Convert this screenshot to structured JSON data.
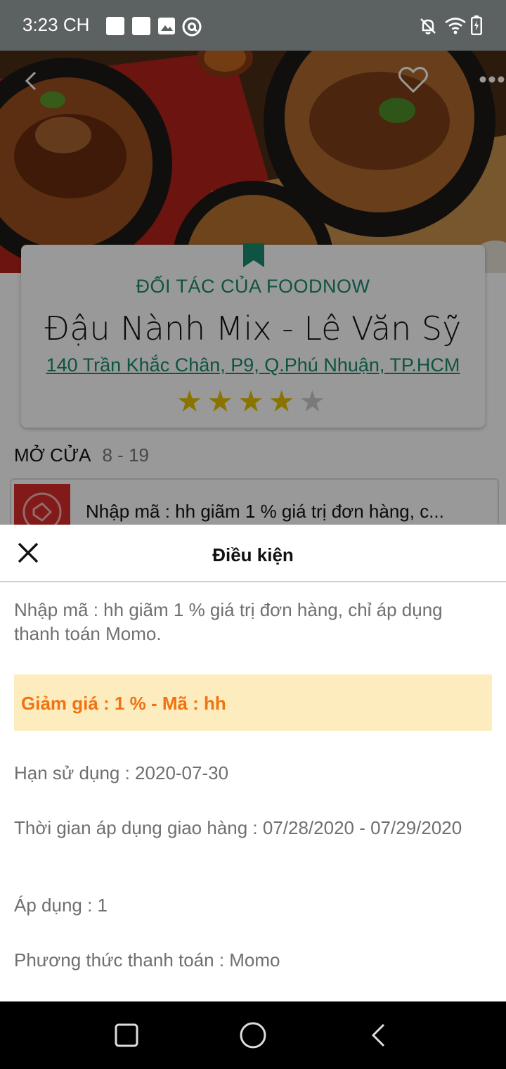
{
  "status_bar": {
    "time": "3:23 CH"
  },
  "restaurant": {
    "partner_label": "ĐỐI TÁC CỦA FOODNOW",
    "name": "Đậu Nành Mix - Lê Văn Sỹ",
    "address": "140 Trần Khắc Chân, P9, Q.Phú Nhuận, TP.HCM",
    "rating": 4,
    "rating_max": 5,
    "hours_label": "MỞ CỬA",
    "hours_value": "8 - 19",
    "coupon_text": "Nhập mã : hh giãm 1 % giá trị đơn hàng, c..."
  },
  "sheet": {
    "title": "Điều kiện",
    "description": "Nhập mã : hh giãm 1 % giá trị đơn hàng, chỉ áp dụng thanh toán Momo.",
    "highlight": "Giảm giá : 1 % - Mã : hh",
    "expiry": "Hạn sử dụng : 2020-07-30",
    "delivery_period": "Thời gian áp dụng giao hàng : 07/28/2020 - 07/29/2020",
    "apply_count": "Áp dụng : 1",
    "payment_method": "Phương thức thanh toán : Momo"
  },
  "colors": {
    "accent_green": "#1a8a6e",
    "highlight_bg": "#fdecbd",
    "highlight_text": "#f07312",
    "star": "#e6c200"
  },
  "icons": [
    "back-arrow-icon",
    "heart-icon",
    "more-icon",
    "bookmark-icon",
    "close-icon",
    "coupon-tag-icon",
    "recent-apps-icon",
    "home-icon",
    "back-nav-icon"
  ]
}
